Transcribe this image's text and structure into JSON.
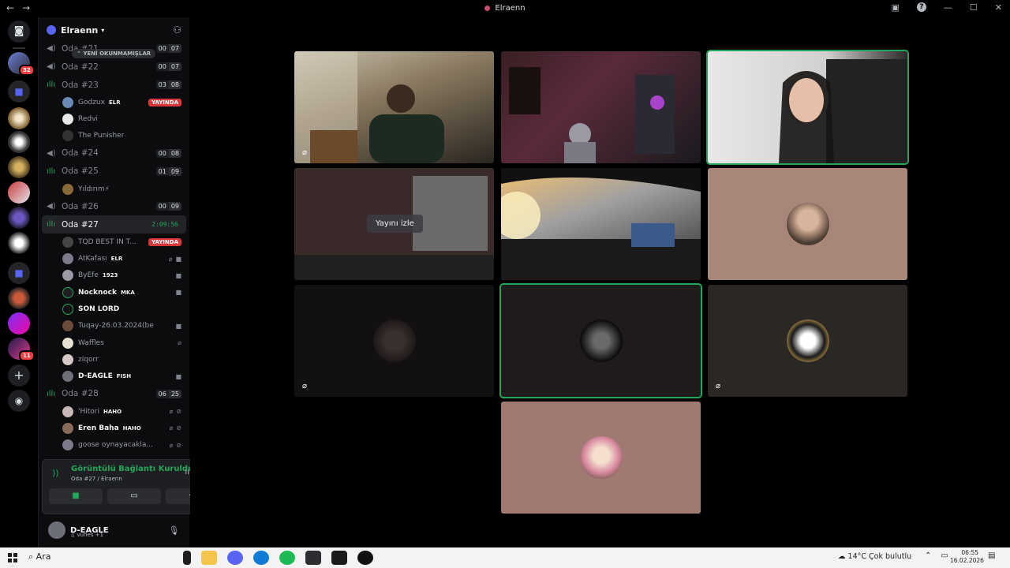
{
  "window": {
    "title": "Elraenn"
  },
  "guild": {
    "name": "Elraenn",
    "unread_pill": "YENİ OKUNMAMIŞLAR"
  },
  "channels": [
    {
      "name": "Oda #21",
      "counts": [
        "00",
        "07"
      ]
    },
    {
      "name": "Oda #22",
      "counts": [
        "00",
        "07"
      ]
    },
    {
      "name": "Oda #23",
      "counts": [
        "03",
        "08"
      ],
      "live": true
    },
    {
      "name": "Oda #24",
      "counts": [
        "00",
        "08"
      ]
    },
    {
      "name": "Oda #25",
      "counts": [
        "01",
        "09"
      ],
      "live": true
    },
    {
      "name": "Oda #26",
      "counts": [
        "00",
        "09"
      ]
    },
    {
      "name": "Oda #27",
      "timer": "2:09:56",
      "live": true
    },
    {
      "name": "Oda #28",
      "counts": [
        "06",
        "25"
      ],
      "live": true
    }
  ],
  "users": {
    "oda23": [
      {
        "name": "Godzux",
        "tag": "ELR",
        "live": "YAYINDA"
      },
      {
        "name": "Redvi"
      },
      {
        "name": "The Punisher"
      }
    ],
    "oda25": [
      {
        "name": "Yıldırım⚡"
      }
    ],
    "oda27": [
      {
        "name": "TQD BEST İN T...",
        "live": "YAYINDA"
      },
      {
        "name": "AtKafası",
        "tag": "ELR"
      },
      {
        "name": "ByEfe",
        "tag": "1923"
      },
      {
        "name": "Nocknock",
        "tag": "MKA"
      },
      {
        "name": "SON LORD"
      },
      {
        "name": "Tuqay-26.03.2024(benden ..."
      },
      {
        "name": "Waffles"
      },
      {
        "name": "ziqorr"
      },
      {
        "name": "D-EAGLE",
        "tag": "FISH"
      }
    ],
    "oda28": [
      {
        "name": "'Hitori",
        "tag": "HAHO"
      },
      {
        "name": "Eren Baha",
        "tag": "HAHO"
      },
      {
        "name": "goose oynayacakla..."
      }
    ]
  },
  "voice_panel": {
    "status": "Görüntülü Bağlantı Kuruldu",
    "channel": "Oda #27 / Elraenn"
  },
  "user_bar": {
    "name": "D-EAGLE",
    "activity": "vunes +1"
  },
  "stage": {
    "watch_label": "Yayını izle"
  },
  "server_badges": {
    "dm": "32",
    "hash": "11"
  },
  "taskbar": {
    "search": "Ara",
    "temp": "14°C",
    "weather": "Çok bulutlu",
    "time": "06:55",
    "date": "16.02.2026"
  }
}
